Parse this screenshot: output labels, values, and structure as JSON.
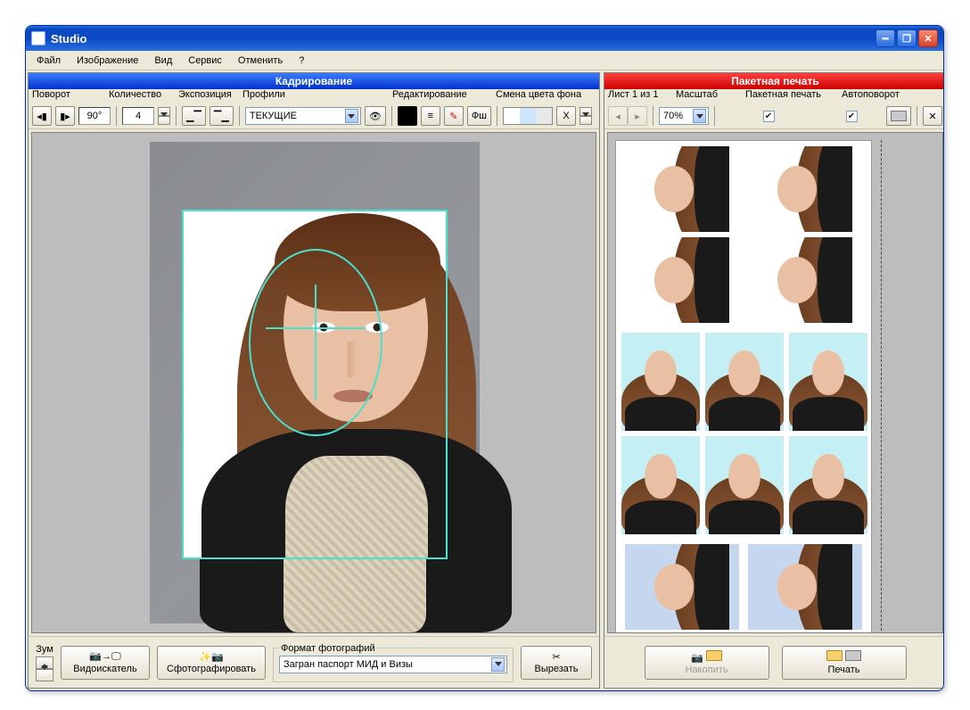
{
  "title": "Studio",
  "menu": [
    "Файл",
    "Изображение",
    "Вид",
    "Сервис",
    "Отменить",
    "?"
  ],
  "left": {
    "header": "Кадрирование",
    "groups": {
      "rotate": {
        "label": "Поворот",
        "angle": "90°"
      },
      "qty": {
        "label": "Количество",
        "value": "4"
      },
      "exposure": {
        "label": "Экспозиция"
      },
      "profiles": {
        "label": "Профили",
        "value": "ТЕКУЩИЕ"
      },
      "editing": {
        "label": "Редактирование",
        "fsh": "Фш"
      },
      "bgcolor": {
        "label": "Смена цвета фона"
      }
    },
    "bottom": {
      "zoom": "Зум",
      "viewfinder": "Видоискатель",
      "capture": "Сфотографировать",
      "format": {
        "legend": "Формат фотографий",
        "value": "Загран паспорт МИД и Визы"
      },
      "cut": "Вырезать"
    }
  },
  "right": {
    "header": "Пакетная печать",
    "groups": {
      "sheet": "Лист 1 из 1",
      "scale": {
        "label": "Масштаб",
        "value": "70%"
      },
      "batch": {
        "label": "Пакетная печать",
        "checked": true
      },
      "autorotate": {
        "label": "Автоповорот",
        "checked": true
      }
    },
    "bottom": {
      "accumulate": "Накопить",
      "print": "Печать"
    }
  }
}
